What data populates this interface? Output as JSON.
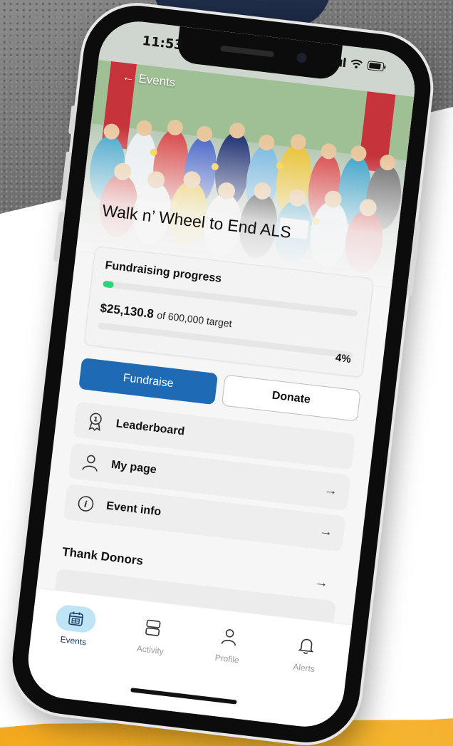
{
  "status_bar": {
    "time": "11:53"
  },
  "header": {
    "back_label": "Events",
    "event_title": "Walk n’ Wheel to End ALS"
  },
  "fundraising": {
    "label": "Fundraising progress",
    "amount": "$25,130.8",
    "target_text": "of 600,000 target",
    "percent_label": "4%",
    "progress_fraction": 0.042,
    "fill_color": "#2bd37a"
  },
  "actions": {
    "fundraise_label": "Fundraise",
    "donate_label": "Donate",
    "primary_color": "#1e6ab5"
  },
  "menu": {
    "items": [
      {
        "label": "Leaderboard",
        "icon": "award-ribbon-icon",
        "arrow": ""
      },
      {
        "label": "My page",
        "icon": "person-icon",
        "arrow": "→"
      },
      {
        "label": "Event info",
        "icon": "info-icon",
        "arrow": "→"
      }
    ]
  },
  "thank_donors": {
    "label": "Thank Donors",
    "arrow": "→"
  },
  "tab_bar": {
    "tabs": [
      {
        "label": "Events",
        "icon": "calendar-icon",
        "active": true
      },
      {
        "label": "Activity",
        "icon": "stacked-cards-icon",
        "active": false
      },
      {
        "label": "Profile",
        "icon": "person-icon",
        "active": false
      },
      {
        "label": "Alerts",
        "icon": "bell-icon",
        "active": false
      }
    ]
  }
}
